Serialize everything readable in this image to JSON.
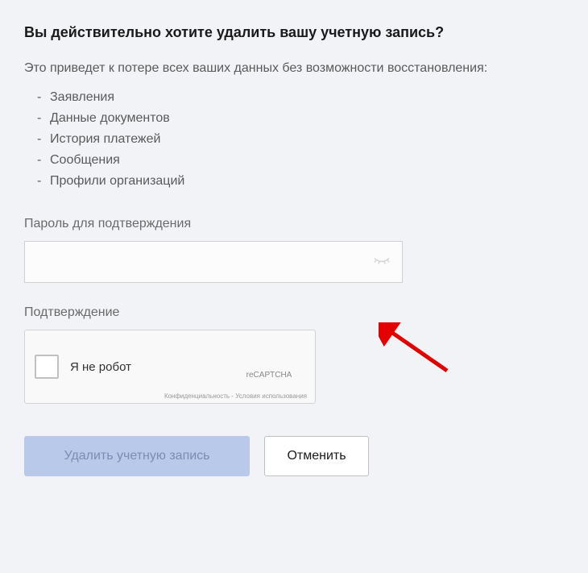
{
  "heading": "Вы действительно хотите удалить вашу учетную запись?",
  "description": "Это приведет к потере всех ваших данных без возможности восстановления:",
  "loss_items": {
    "0": "Заявления",
    "1": "Данные документов",
    "2": "История платежей",
    "3": "Сообщения",
    "4": "Профили организаций"
  },
  "password": {
    "label": "Пароль для подтверждения",
    "value": ""
  },
  "confirmation": {
    "label": "Подтверждение"
  },
  "recaptcha": {
    "checkbox_label": "Я не робот",
    "brand": "reCAPTCHA",
    "terms": "Конфиденциальность - Условия использования"
  },
  "buttons": {
    "delete": "Удалить учетную запись",
    "cancel": "Отменить"
  }
}
